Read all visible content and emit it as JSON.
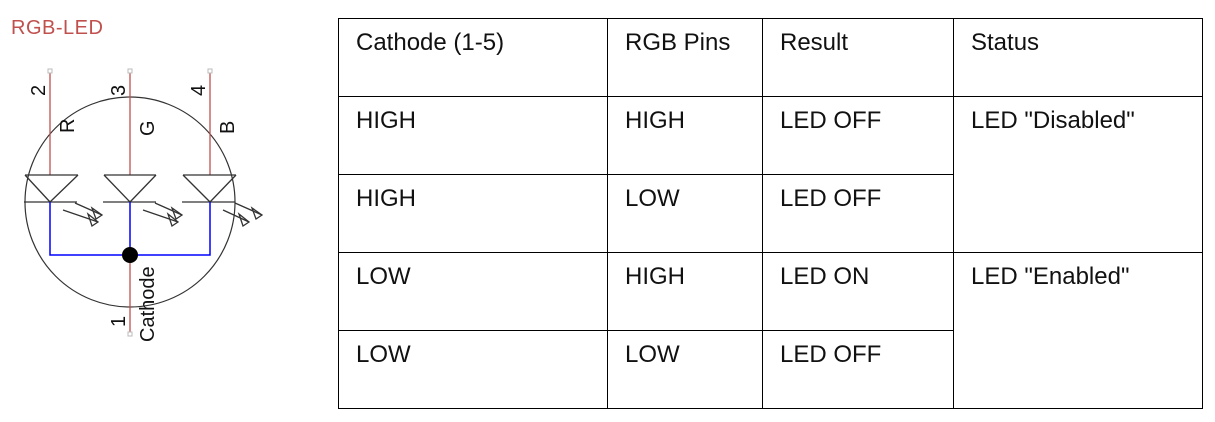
{
  "schematic": {
    "title": "RGB-LED",
    "pins": [
      {
        "number": "2",
        "label": "R"
      },
      {
        "number": "3",
        "label": "G"
      },
      {
        "number": "4",
        "label": "B"
      },
      {
        "number": "1",
        "label": "Cathode"
      }
    ],
    "colors": {
      "anode_wire": "#c0504d",
      "cathode_wire": "#0000ff",
      "title": "#c0504d"
    }
  },
  "table": {
    "headers": [
      "Cathode (1-5)",
      "RGB Pins",
      "Result",
      "Status"
    ],
    "rows": [
      [
        "HIGH",
        "HIGH",
        "LED OFF"
      ],
      [
        "HIGH",
        "LOW",
        "LED OFF"
      ],
      [
        "LOW",
        "HIGH",
        "LED ON"
      ],
      [
        "LOW",
        "LOW",
        "LED OFF"
      ]
    ],
    "status": [
      "LED \"Disabled\"",
      "LED \"Enabled\""
    ]
  }
}
